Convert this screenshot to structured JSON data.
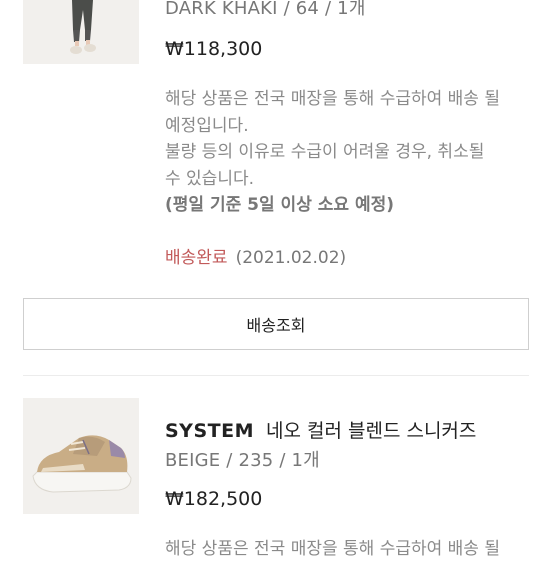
{
  "items": [
    {
      "option": "DARK KHAKI / 64 / 1개",
      "price": "₩118,300",
      "notice_lines": [
        "해당 상품은 전국 매장을 통해 수급하여 배송 될",
        "예정입니다.",
        "불량 등의 이유로 수급이 어려울 경우, 취소될",
        "수 있습니다."
      ],
      "notice_bold": "(평일 기준 5일 이상 소요 예정)",
      "status": "배송완료",
      "status_date": "(2021.02.02)",
      "button_label": "배송조회"
    },
    {
      "brand": "SYSTEM",
      "name": "네오 컬러 블렌드 스니커즈",
      "option": "BEIGE / 235 / 1개",
      "price": "₩182,500",
      "notice_lines": [
        "해당 상품은 전국 매장을 통해 수급하여 배송 될"
      ]
    }
  ],
  "colors": {
    "status_done": "#c25a5a",
    "muted_text": "#8a8a8a",
    "border": "#cfcfcf"
  }
}
